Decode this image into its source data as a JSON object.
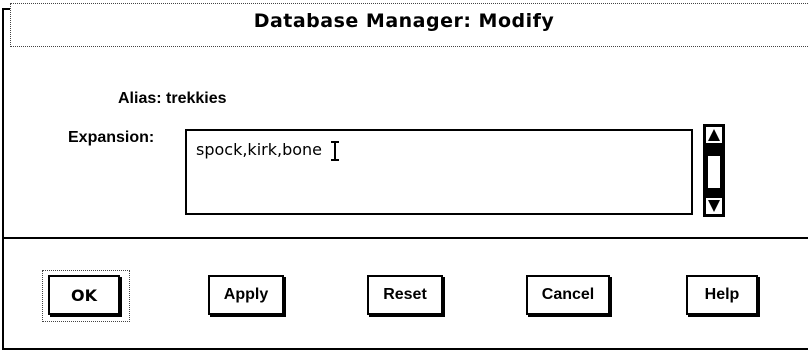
{
  "window": {
    "title": "Database Manager: Modify"
  },
  "form": {
    "alias_label": "Alias:",
    "alias_value": "trekkies",
    "expansion_label": "Expansion:",
    "expansion_value": "spock,kirk,bone"
  },
  "scrollbar": {
    "up_icon": "arrow-up-icon",
    "down_icon": "arrow-down-icon"
  },
  "buttons": {
    "ok": "OK",
    "apply": "Apply",
    "reset": "Reset",
    "cancel": "Cancel",
    "help": "Help"
  }
}
